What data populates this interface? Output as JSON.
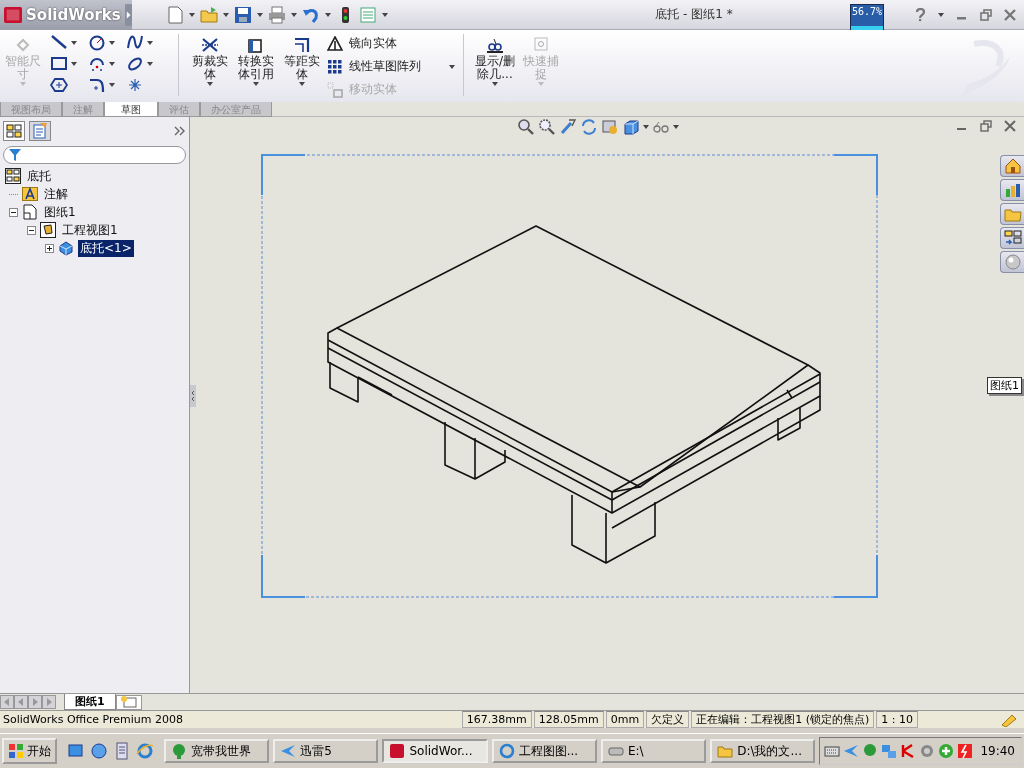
{
  "title_bar": {
    "logo": "SolidWorks",
    "title": "底托 - 图纸1 *",
    "meter": "56.7%"
  },
  "ribbon": {
    "smart_dimension": {
      "label": "智能尺寸",
      "disabled": true
    },
    "large_tools": [
      {
        "label": "剪裁实体",
        "disabled": false
      },
      {
        "label": "转换实体引用",
        "disabled": false
      },
      {
        "label": "等距实体",
        "disabled": false
      }
    ],
    "small_tools": [
      {
        "label": "镜向实体",
        "disabled": false
      },
      {
        "label": "线性草图阵列",
        "disabled": false
      },
      {
        "label": "移动实体",
        "disabled": true
      }
    ],
    "right_tools": [
      {
        "label": "显示/删除几...",
        "disabled": false
      },
      {
        "label": "快速捕捉",
        "disabled": true
      }
    ]
  },
  "ribbon_tabs": [
    {
      "label": "视图布局",
      "selected": false
    },
    {
      "label": "注解",
      "selected": false
    },
    {
      "label": "草图",
      "selected": true
    },
    {
      "label": "评估",
      "selected": false
    },
    {
      "label": "办公室产品",
      "selected": false
    }
  ],
  "feature_tree": {
    "root": {
      "label": "底托",
      "selected": false,
      "children": [
        {
          "label": "注解",
          "selected": false
        },
        {
          "label": "图纸1",
          "selected": false,
          "expanded": true,
          "children": [
            {
              "label": "工程视图1",
              "selected": false,
              "expanded": true,
              "children": [
                {
                  "label": "底托<1>",
                  "selected": true,
                  "expanded": false
                }
              ]
            }
          ]
        }
      ]
    }
  },
  "graphics": {
    "sheet_label": "图纸1"
  },
  "sheet_tabs": [
    {
      "label": "图纸1",
      "selected": true
    }
  ],
  "status_bar": {
    "product": "SolidWorks Office Premium 2008",
    "x": "167.38mm",
    "y": "128.05mm",
    "z": "0mm",
    "state": "欠定义",
    "editing": "正在编辑：工程视图1 (锁定的焦点)",
    "scale": "1 : 10"
  },
  "taskbar": {
    "start": "开始",
    "windows": [
      {
        "label": "宽带我世界",
        "selected": false
      },
      {
        "label": "迅雷5",
        "selected": false
      },
      {
        "label": "SolidWor...",
        "selected": true
      },
      {
        "label": "工程图图...",
        "selected": false
      },
      {
        "label": "E:\\",
        "selected": false
      },
      {
        "label": "D:\\我的文...",
        "selected": false
      }
    ],
    "clock": "19:40"
  }
}
